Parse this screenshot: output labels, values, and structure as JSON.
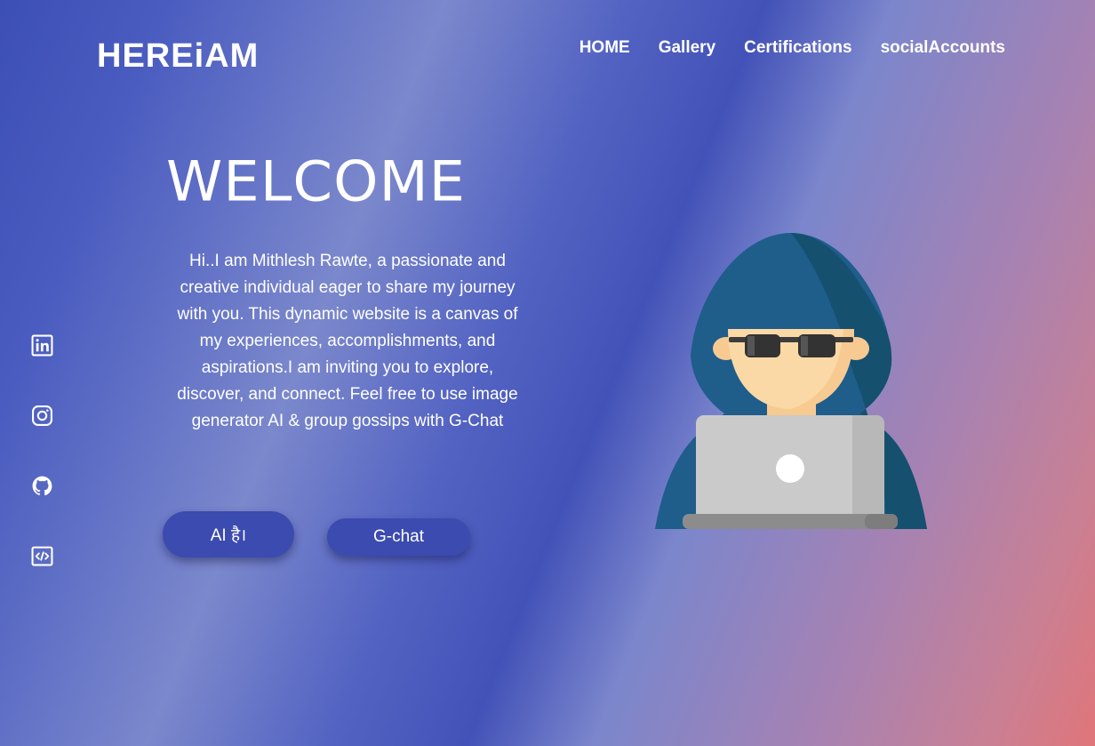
{
  "header": {
    "logo": "HEREiAM",
    "nav": [
      "HOME",
      "Gallery",
      "Certifications",
      "socialAccounts"
    ]
  },
  "social_icons": [
    "linkedin-icon",
    "instagram-icon",
    "github-icon",
    "code-icon"
  ],
  "hero": {
    "title": "WELCOME",
    "intro": "Hi..I am Mithlesh Rawte, a passionate and creative individual eager to share my journey with you. This dynamic website is a canvas of my experiences, accomplishments, and aspirations.I am inviting you to explore, discover, and connect. Feel free to use image generator AI & group gossips with G-Chat",
    "buttons": {
      "ai": "AI है।",
      "chat": "G-chat"
    },
    "illustration": "hacker-laptop-illustration"
  },
  "colors": {
    "gradient_start": "#3c4fb4",
    "gradient_end": "#e0757a",
    "button": "#3b4bb0",
    "text": "#ffffff"
  }
}
